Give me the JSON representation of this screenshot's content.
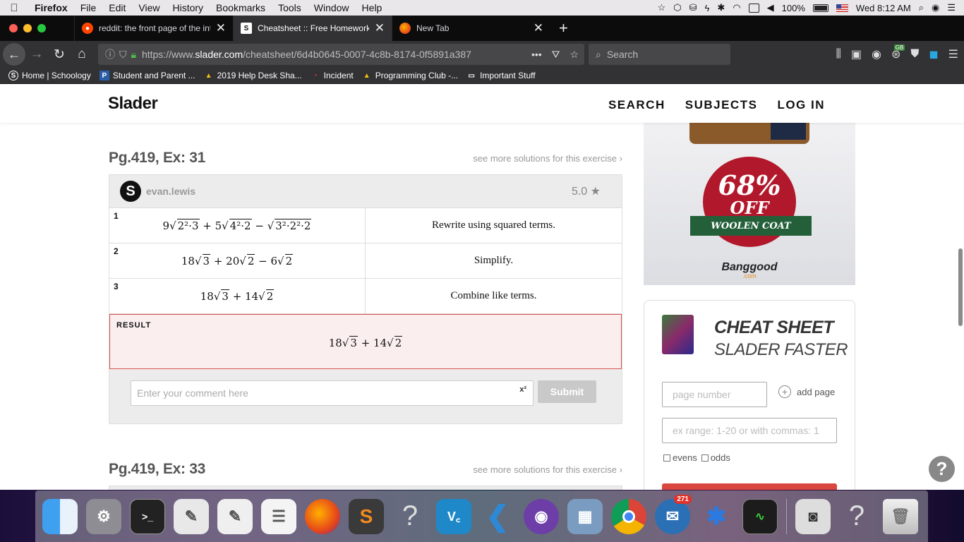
{
  "menubar": {
    "app_name": "Firefox",
    "items": [
      "File",
      "Edit",
      "View",
      "History",
      "Bookmarks",
      "Tools",
      "Window",
      "Help"
    ],
    "battery": "100%",
    "clock": "Wed 8:12 AM"
  },
  "tabs": [
    {
      "title": "reddit: the front page of the inte",
      "favicon": "reddit-icon",
      "active": false
    },
    {
      "title": "Cheatsheet :: Free Homework H",
      "favicon": "slader-icon",
      "active": true
    },
    {
      "title": "New Tab",
      "favicon": "firefox-icon",
      "active": false
    }
  ],
  "navbar": {
    "url_prefix": "https://www.",
    "url_domain": "slader.com",
    "url_path": "/cheatsheet/6d4b0645-0007-4c8b-8174-0f5891a387",
    "search_placeholder": "Search",
    "extension_badge": "GB"
  },
  "bookmarks": [
    {
      "label": "Home | Schoology",
      "icon": "schoology-icon"
    },
    {
      "label": "Student and Parent ...",
      "icon": "powerschool-icon"
    },
    {
      "label": "2019 Help Desk Sha...",
      "icon": "drive-icon"
    },
    {
      "label": "Incident",
      "icon": "incident-icon"
    },
    {
      "label": "Programming Club -...",
      "icon": "drive-icon"
    },
    {
      "label": "Important Stuff",
      "icon": "folder-icon"
    }
  ],
  "site": {
    "logo": "Slader",
    "nav": [
      "SEARCH",
      "SUBJECTS",
      "LOG IN"
    ]
  },
  "exercise1": {
    "title": "Pg.419, Ex: 31",
    "see_more": "see more solutions for this exercise",
    "author": "evan.lewis",
    "rating": "5.0",
    "steps": [
      {
        "num": "1",
        "desc": "Rewrite using squared terms."
      },
      {
        "num": "2",
        "desc": "Simplify."
      },
      {
        "num": "3",
        "desc": "Combine like terms."
      }
    ],
    "result_label": "RESULT",
    "comment_placeholder": "Enter your comment here",
    "comment_sup": "x²",
    "submit_label": "Submit"
  },
  "exercise2": {
    "title": "Pg.419, Ex: 33",
    "see_more": "see more solutions for this exercise"
  },
  "ad": {
    "percent": "68%",
    "off": "OFF",
    "ribbon": "WOOLEN COAT",
    "brand": "Banggood",
    "brand_suffix": ".com"
  },
  "cheatsheet": {
    "title1": "CHEAT SHEET",
    "title2": "SLADER FASTER",
    "page_placeholder": "page number",
    "add_page": "add page",
    "range_placeholder": "ex range: 1-20  or  with commas: 1",
    "evens": "evens",
    "odds": "odds"
  },
  "help": "?",
  "dock": {
    "mail_badge": "271"
  }
}
